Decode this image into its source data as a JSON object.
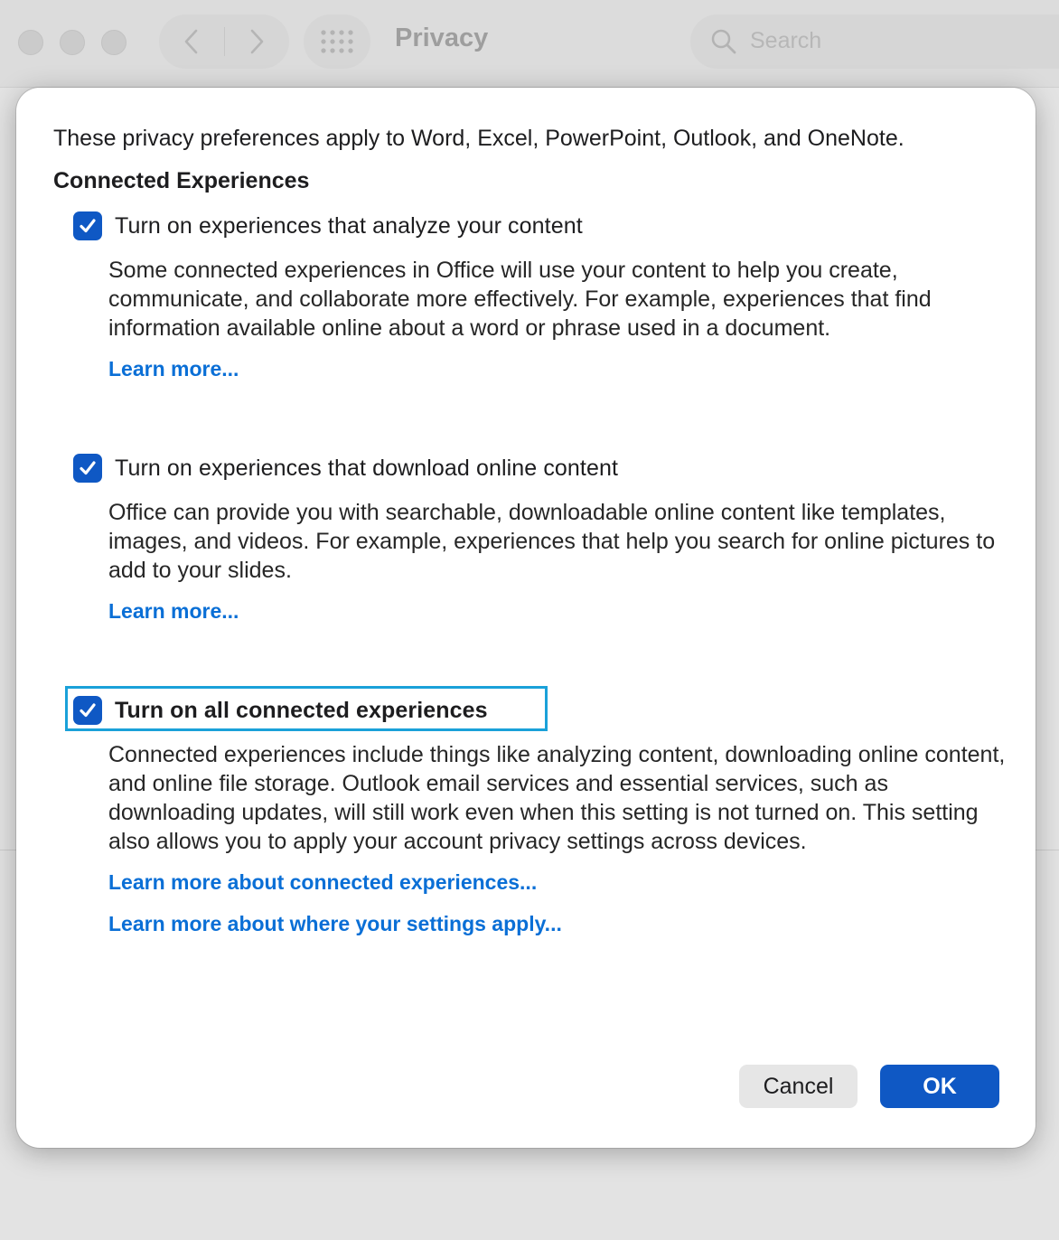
{
  "window": {
    "title": "Privacy",
    "search_placeholder": "Search"
  },
  "dialog": {
    "intro": "These privacy preferences apply to Word, Excel, PowerPoint, Outlook, and OneNote.",
    "section_heading": "Connected Experiences",
    "options": [
      {
        "label": "Turn on experiences that analyze your content",
        "checked": true,
        "description": "Some connected experiences in Office will use your content to help you create, communicate, and collaborate more effectively. For example, experiences that find information available online about a word or phrase used in a document.",
        "links": [
          "Learn more..."
        ]
      },
      {
        "label": "Turn on experiences that download online content",
        "checked": true,
        "description": "Office can provide you with searchable, downloadable online content like templates, images, and videos. For example, experiences that help you search for online pictures to add to your slides.",
        "links": [
          "Learn more..."
        ]
      },
      {
        "label": "Turn on all connected experiences",
        "checked": true,
        "focused": true,
        "description": "Connected experiences include things like analyzing content, downloading online content, and online file storage. Outlook email services and essential services, such as downloading updates, will still work even when this setting is not turned on. This setting also allows you to apply your account privacy settings across devices.",
        "links": [
          "Learn more about connected experiences...",
          "Learn more about where your settings apply..."
        ]
      }
    ],
    "buttons": {
      "cancel": "Cancel",
      "ok": "OK"
    }
  },
  "colors": {
    "accent": "#0f58c4",
    "link": "#0a6fd6",
    "focus_ring": "#1aa1d9"
  },
  "icons": [
    "close-dot-icon",
    "minimize-dot-icon",
    "zoom-dot-icon",
    "chevron-left-icon",
    "chevron-right-icon",
    "grid-icon",
    "search-icon",
    "checkmark-icon"
  ]
}
